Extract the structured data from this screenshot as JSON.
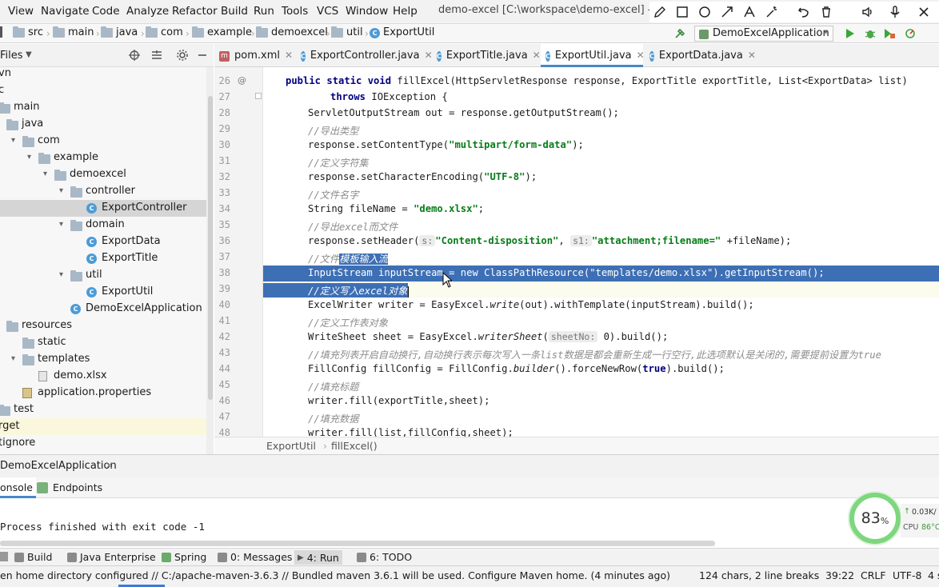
{
  "menu": {
    "items": [
      "View",
      "Navigate",
      "Code",
      "Analyze",
      "Refactor",
      "Build",
      "Run",
      "Tools",
      "VCS",
      "Window",
      "Help"
    ],
    "window_title": "demo-excel [C:\\workspace\\demo-excel] - ...\\"
  },
  "navbar": {
    "crumbs": [
      "src",
      "main",
      "java",
      "com",
      "example",
      "demoexcel",
      "util",
      "ExportUtil"
    ],
    "run_config": "DemoExcelApplication"
  },
  "project": {
    "header": "Files",
    "rows": [
      {
        "label": "vn",
        "indent": 0
      },
      {
        "label": "c",
        "indent": 0
      },
      {
        "label": "main",
        "indent": 0,
        "icon": "folder"
      },
      {
        "label": "java",
        "indent": 1,
        "icon": "folder"
      },
      {
        "label": "com",
        "indent": 2,
        "icon": "folder",
        "open": true
      },
      {
        "label": "example",
        "indent": 3,
        "icon": "folder",
        "open": true
      },
      {
        "label": "demoexcel",
        "indent": 4,
        "icon": "folder",
        "open": true
      },
      {
        "label": "controller",
        "indent": 5,
        "icon": "folder",
        "open": true
      },
      {
        "label": "ExportController",
        "indent": 6,
        "icon": "class",
        "selected": true
      },
      {
        "label": "domain",
        "indent": 5,
        "icon": "folder",
        "open": true
      },
      {
        "label": "ExportData",
        "indent": 6,
        "icon": "class"
      },
      {
        "label": "ExportTitle",
        "indent": 6,
        "icon": "class"
      },
      {
        "label": "util",
        "indent": 5,
        "icon": "folder",
        "open": true
      },
      {
        "label": "ExportUtil",
        "indent": 6,
        "icon": "class"
      },
      {
        "label": "DemoExcelApplication",
        "indent": 5,
        "icon": "class"
      },
      {
        "label": "resources",
        "indent": 1,
        "icon": "folder"
      },
      {
        "label": "static",
        "indent": 2,
        "icon": "folder"
      },
      {
        "label": "templates",
        "indent": 2,
        "icon": "folder",
        "open": true
      },
      {
        "label": "demo.xlsx",
        "indent": 3,
        "icon": "xlsx"
      },
      {
        "label": "application.properties",
        "indent": 2,
        "icon": "props"
      },
      {
        "label": "test",
        "indent": 0,
        "icon": "folder"
      },
      {
        "label": "rget",
        "indent": 0,
        "highlight": true
      },
      {
        "label": "tignore",
        "indent": 0
      }
    ]
  },
  "tabs": [
    {
      "label": "pom.xml",
      "icon": "m"
    },
    {
      "label": "ExportController.java",
      "icon": "c"
    },
    {
      "label": "ExportTitle.java",
      "icon": "c"
    },
    {
      "label": "ExportUtil.java",
      "icon": "c",
      "active": true
    },
    {
      "label": "ExportData.java",
      "icon": "c"
    }
  ],
  "editor": {
    "line_numbers": [
      "26",
      "27",
      "28",
      "29",
      "30",
      "31",
      "32",
      "33",
      "34",
      "35",
      "36",
      "37",
      "38",
      "39",
      "40",
      "41",
      "42",
      "43",
      "44",
      "45",
      "46",
      "47",
      "48"
    ],
    "gutter_marker": "@",
    "lines": {
      "l26_kw": "public static void ",
      "l26_rest": "fillExcel(HttpServletResponse response, ExportTitle exportTitle, List<ExportData> list)",
      "l27_kw": "throws ",
      "l27_rest": "IOException {",
      "l28": "ServletOutputStream out = response.getOutputStream();",
      "l29": "//导出类型",
      "l30_a": "response.setContentType(",
      "l30_s": "\"multipart/form-data\"",
      "l30_b": ");",
      "l31": "//定义字符集",
      "l32_a": "response.setCharacterEncoding(",
      "l32_s": "\"UTF-8\"",
      "l32_b": ");",
      "l33": "//文件名字",
      "l34_a": "String fileName = ",
      "l34_s": "\"demo.xlsx\"",
      "l34_b": ";",
      "l35": "//导出excel而文件",
      "l36_a": "response.setHeader(",
      "l36_h1": "s:",
      "l36_s1": "\"Content-disposition\"",
      "l36_c": ", ",
      "l36_h2": "s1:",
      "l36_s2": "\"attachment;filename=\"",
      "l36_b": " +fileName);",
      "l37_a": "//文件",
      "l37_s": "模板输入流",
      "l38": "InputStream inputStream = new ClassPathResource(\"templates/demo.xlsx\").getInputStream();",
      "l39_s": "//定义写入excel对象",
      "l40_a": "ExcelWriter writer = EasyExcel.",
      "l40_i": "write",
      "l40_b": "(out).withTemplate(inputStream).build();",
      "l41": "//定义工作表对象",
      "l42_a": "WriteSheet sheet = EasyExcel.",
      "l42_i": "writerSheet",
      "l42_b": "(",
      "l42_h": "sheetNo:",
      "l42_c": " 0).build();",
      "l43": "//填充列表开启自动换行,自动换行表示每次写入一条list数据是都会重新生成一行空行,此选项默认是关闭的,需要提前设置为true",
      "l44_a": "FillConfig fillConfig = FillConfig.",
      "l44_i": "builder",
      "l44_b": "().forceNewRow(",
      "l44_k": "true",
      "l44_c": ").build();",
      "l45": "//填充标题",
      "l46": "writer.fill(exportTitle,sheet);",
      "l47": "//填充数据",
      "l48": "writer.fill(list,fillConfig,sheet);"
    },
    "breadcrumb": [
      "ExportUtil",
      "fillExcel()"
    ]
  },
  "run": {
    "config_tab": "DemoExcelApplication",
    "tabs": [
      "onsole",
      "Endpoints"
    ],
    "console_text": "Process finished with exit code -1"
  },
  "tool_strip": [
    {
      "label": "Build"
    },
    {
      "label": "Java Enterprise"
    },
    {
      "label": "Spring"
    },
    {
      "label": "0: Messages"
    },
    {
      "label": "4: Run",
      "active": true
    },
    {
      "label": "6: TODO"
    }
  ],
  "status": {
    "message": "en home directory configured // C:/apache-maven-3.6.3 // Bundled maven 3.6.1 will be used.  Configure Maven home. (4 minutes ago)",
    "selection": "124 chars, 2 line breaks",
    "position": "39:22",
    "line_sep": "CRLF",
    "encoding": "UTF-8",
    "indent": "4 s"
  },
  "widget": {
    "percent": "83",
    "percent_unit": "%",
    "net": "0.03K/",
    "cpu_label": "CPU",
    "cpu_value": "86°C"
  },
  "colors": {
    "selection": "#3d6fb5",
    "accent": "#4a88c7",
    "cpu_ring": "#7ed67e"
  }
}
